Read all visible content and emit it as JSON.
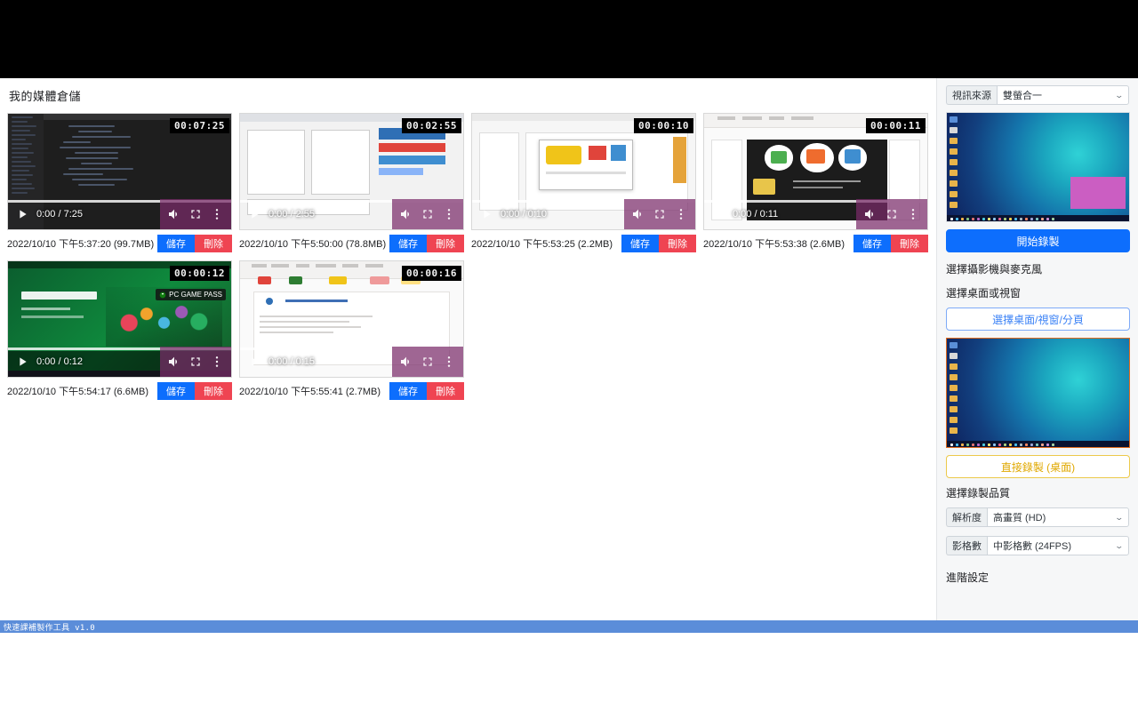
{
  "app": {
    "title": "我的媒體倉儲",
    "status_bar": "快速課補製作工具 v1.0"
  },
  "player_icons": {
    "play": "play-icon",
    "volume": "volume-icon",
    "fullscreen": "fullscreen-icon",
    "menu": "kebab-menu-icon"
  },
  "buttons": {
    "save_label": "儲存",
    "delete_label": "刪除"
  },
  "colors": {
    "save_blue": "#0d6efd",
    "delete_red": "#ef4452",
    "outline_blue": "#7eaaf7",
    "outline_yellow": "#ecc94b",
    "status_bar_blue": "#5b8dd9",
    "preview_border_orange": "#e06a1b"
  },
  "videos": [
    {
      "duration_badge": "00:07:25",
      "time_display": "0:00 / 7:25",
      "timestamp": "2022/10/10 下午5:37:20 (99.7MB)",
      "art": "ide"
    },
    {
      "duration_badge": "00:02:55",
      "time_display": "0:00 / 2:55",
      "timestamp": "2022/10/10 下午5:50:00 (78.8MB)",
      "art": "browser"
    },
    {
      "duration_badge": "00:00:10",
      "time_display": "0:00 / 0:10",
      "timestamp": "2022/10/10 下午5:53:25 (2.2MB)",
      "art": "doc"
    },
    {
      "duration_badge": "00:00:11",
      "time_display": "0:00 / 0:11",
      "timestamp": "2022/10/10 下午5:53:38 (2.6MB)",
      "art": "slide"
    },
    {
      "duration_badge": "00:00:12",
      "time_display": "0:00 / 0:12",
      "timestamp": "2022/10/10 下午5:54:17 (6.6MB)",
      "art": "gamepass"
    },
    {
      "duration_badge": "00:00:16",
      "time_display": "0:00 / 0:15",
      "timestamp": "2022/10/10 下午5:55:41 (2.7MB)",
      "art": "office"
    }
  ],
  "sidebar": {
    "source_label": "視訊來源",
    "source_value": "雙螢合一",
    "start_record_label": "開始錄製",
    "camera_mic_heading": "選擇攝影機與麥克風",
    "desktop_window_heading": "選擇桌面或視窗",
    "choose_source_label": "選擇桌面/視窗/分頁",
    "direct_record_label": "直接錄製 (桌面)",
    "quality_heading": "選擇錄製品質",
    "resolution_label": "解析度",
    "resolution_value": "高畫質 (HD)",
    "framerate_label": "影格數",
    "framerate_value": "中影格數 (24FPS)",
    "advanced_label": "進階設定",
    "chevron": "⌄"
  }
}
